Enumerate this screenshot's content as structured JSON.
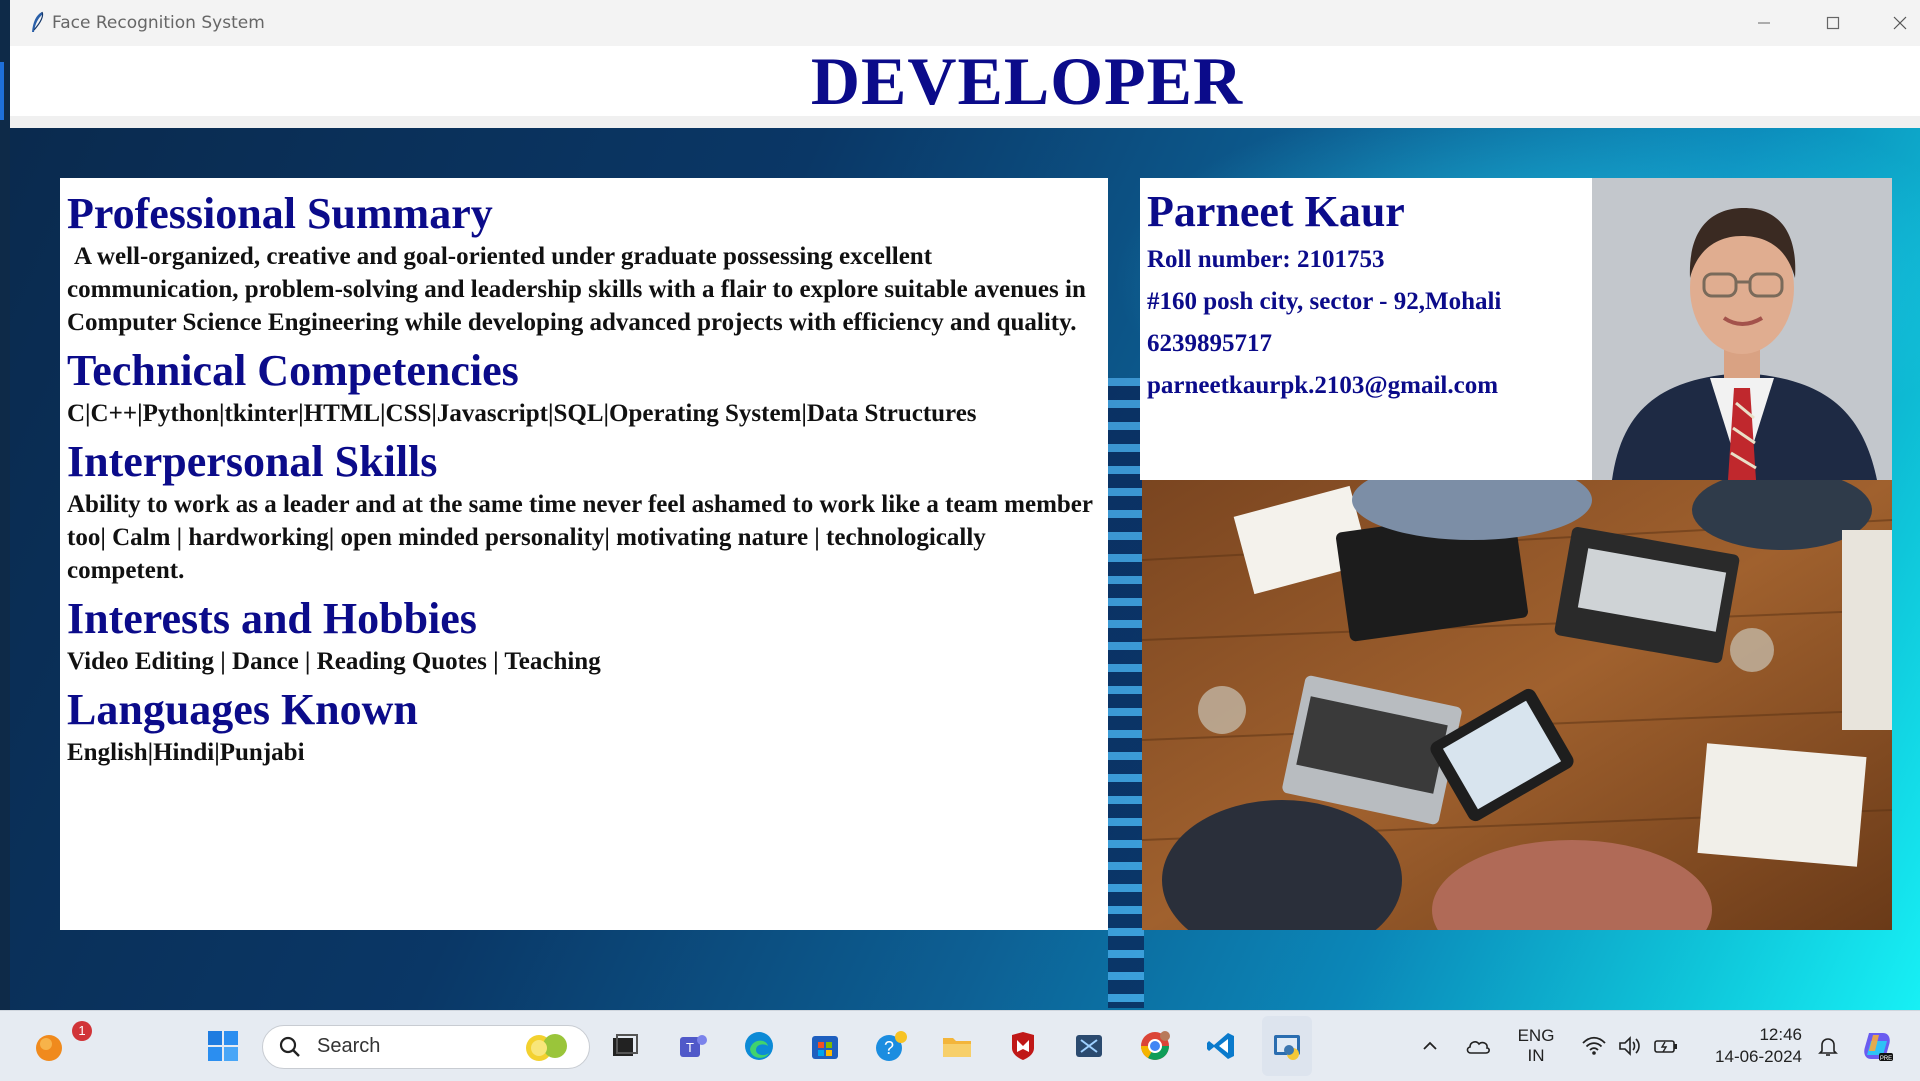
{
  "window": {
    "title": "Face Recognition System",
    "header": "DEVELOPER"
  },
  "summary": {
    "sections": [
      {
        "title": "Professional Summary",
        "body": "A well-organized, creative and goal-oriented under graduate possessing excellent communication, problem-solving and leadership skills with a flair to explore suitable avenues in Computer Science Engineering while developing advanced projects with efficiency and quality."
      },
      {
        "title": "Technical Competencies",
        "body": "C|C++|Python|tkinter|HTML|CSS|Javascript|SQL|Operating System|Data Structures"
      },
      {
        "title": "Interpersonal Skills",
        "body": "Ability to work as a leader and at the same time never feel ashamed to work like a team member too| Calm | hardworking| open minded personality| motivating nature  | technologically competent."
      },
      {
        "title": "Interests and Hobbies",
        "body": "Video Editing | Dance | Reading Quotes | Teaching"
      },
      {
        "title": "Languages Known",
        "body": "English|Hindi|Punjabi"
      }
    ]
  },
  "profile": {
    "name": "Parneet Kaur",
    "roll": "Roll number: 2101753",
    "address": "#160 posh city, sector - 92,Mohali",
    "phone": "6239895717",
    "email": "parneetkaurpk.2103@gmail.com"
  },
  "taskbar": {
    "search_placeholder": "Search",
    "notification_count": "1",
    "lang_top": "ENG",
    "lang_bottom": "IN",
    "time": "12:46",
    "date": "14-06-2024",
    "icons": [
      "weather-icon",
      "windows-start-icon",
      "task-view-icon",
      "teams-icon",
      "edge-icon",
      "store-icon",
      "help-icon",
      "file-explorer-icon",
      "mcafee-icon",
      "snipping-tool-icon",
      "chrome-icon",
      "vscode-icon",
      "python-app-icon"
    ]
  },
  "colors": {
    "heading": "#0b0b8a",
    "accent": "#0fc6da"
  }
}
